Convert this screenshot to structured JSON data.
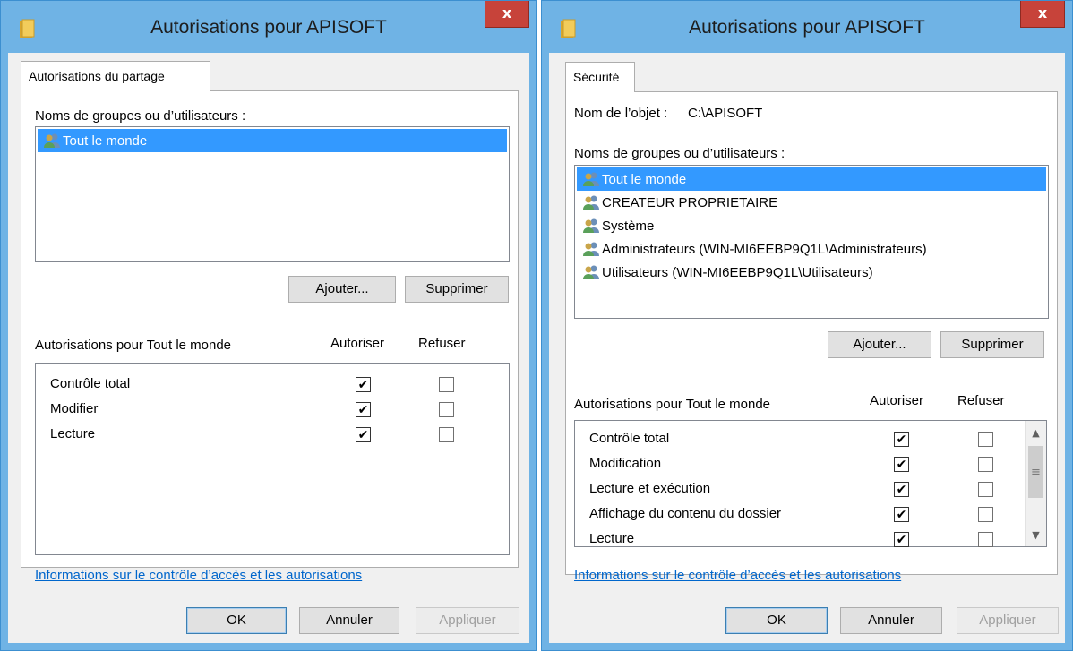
{
  "icons": {
    "folder": "folder-icon",
    "users": "users-group-icon",
    "close": "close-icon",
    "check": "checkmark-icon"
  },
  "colors": {
    "accent": "#6fb3e5",
    "selection": "#3399ff",
    "close_button": "#c7433a",
    "link": "#0066cc"
  },
  "left": {
    "title": "Autorisations pour APISOFT",
    "close_label": "x",
    "tab_label": "Autorisations du partage",
    "groups_label": "Noms de groupes ou d’utilisateurs :",
    "groups": [
      {
        "name": "Tout le monde",
        "selected": true
      }
    ],
    "add_button": "Ajouter...",
    "remove_button": "Supprimer",
    "permissions_for": "Autorisations pour Tout le monde",
    "allow_header": "Autoriser",
    "deny_header": "Refuser",
    "permissions": [
      {
        "name": "Contrôle total",
        "allow": true,
        "deny": false
      },
      {
        "name": "Modifier",
        "allow": true,
        "deny": false
      },
      {
        "name": "Lecture",
        "allow": true,
        "deny": false
      }
    ],
    "info_link": "Informations sur le contrôle d’accès et les autorisations",
    "ok_button": "OK",
    "cancel_button": "Annuler",
    "apply_button": "Appliquer"
  },
  "right": {
    "title": "Autorisations pour APISOFT",
    "close_label": "x",
    "tab_label": "Sécurité",
    "object_name_label": "Nom de l’objet :",
    "object_name_value": "C:\\APISOFT",
    "groups_label": "Noms de groupes ou d’utilisateurs :",
    "groups": [
      {
        "name": "Tout le monde",
        "selected": true
      },
      {
        "name": "CREATEUR PROPRIETAIRE",
        "selected": false
      },
      {
        "name": "Système",
        "selected": false
      },
      {
        "name": "Administrateurs (WIN-MI6EEBP9Q1L\\Administrateurs)",
        "selected": false
      },
      {
        "name": "Utilisateurs (WIN-MI6EEBP9Q1L\\Utilisateurs)",
        "selected": false
      }
    ],
    "add_button": "Ajouter...",
    "remove_button": "Supprimer",
    "permissions_for": "Autorisations pour Tout le monde",
    "allow_header": "Autoriser",
    "deny_header": "Refuser",
    "permissions": [
      {
        "name": "Contrôle total",
        "allow": true,
        "deny": false
      },
      {
        "name": "Modification",
        "allow": true,
        "deny": false
      },
      {
        "name": "Lecture et exécution",
        "allow": true,
        "deny": false
      },
      {
        "name": "Affichage du contenu du dossier",
        "allow": true,
        "deny": false
      },
      {
        "name": "Lecture",
        "allow": true,
        "deny": false
      }
    ],
    "info_link": "Informations sur le contrôle d’accès et les autorisations",
    "ok_button": "OK",
    "cancel_button": "Annuler",
    "apply_button": "Appliquer"
  }
}
